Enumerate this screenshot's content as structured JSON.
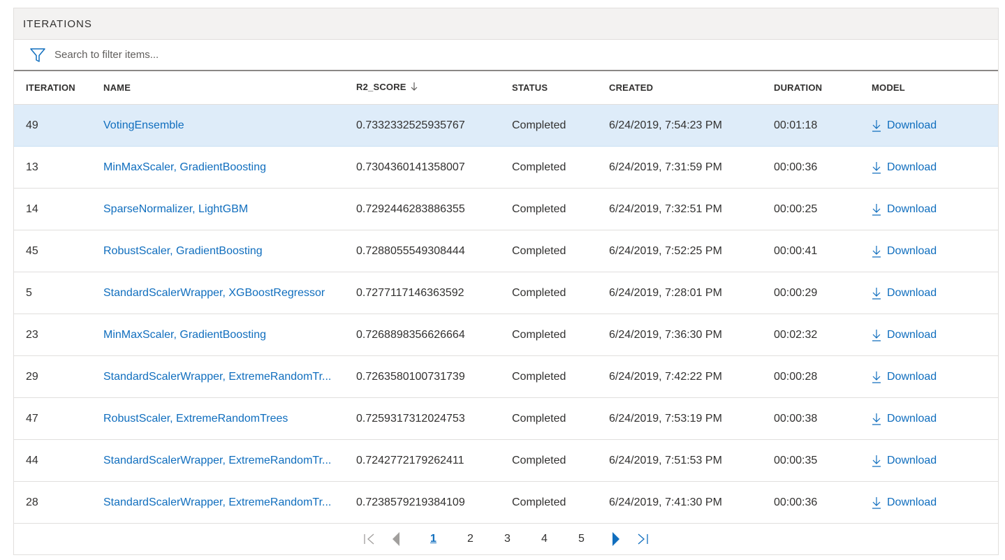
{
  "panel": {
    "title": "ITERATIONS"
  },
  "search": {
    "placeholder": "Search to filter items..."
  },
  "columns": {
    "iteration": "ITERATION",
    "name": "NAME",
    "score": "R2_SCORE",
    "status": "STATUS",
    "created": "CREATED",
    "duration": "DURATION",
    "model": "MODEL"
  },
  "sort": {
    "column": "R2_SCORE",
    "direction": "descending",
    "icon": "arrow-down-icon"
  },
  "rows": [
    {
      "iteration": "49",
      "name": "VotingEnsemble",
      "score": "0.7332332525935767",
      "status": "Completed",
      "created": "6/24/2019, 7:54:23 PM",
      "duration": "00:01:18",
      "model": "Download",
      "selected": true
    },
    {
      "iteration": "13",
      "name": "MinMaxScaler, GradientBoosting",
      "score": "0.7304360141358007",
      "status": "Completed",
      "created": "6/24/2019, 7:31:59 PM",
      "duration": "00:00:36",
      "model": "Download"
    },
    {
      "iteration": "14",
      "name": "SparseNormalizer, LightGBM",
      "score": "0.7292446283886355",
      "status": "Completed",
      "created": "6/24/2019, 7:32:51 PM",
      "duration": "00:00:25",
      "model": "Download"
    },
    {
      "iteration": "45",
      "name": "RobustScaler, GradientBoosting",
      "score": "0.7288055549308444",
      "status": "Completed",
      "created": "6/24/2019, 7:52:25 PM",
      "duration": "00:00:41",
      "model": "Download"
    },
    {
      "iteration": "5",
      "name": "StandardScalerWrapper, XGBoostRegressor",
      "score": "0.7277117146363592",
      "status": "Completed",
      "created": "6/24/2019, 7:28:01 PM",
      "duration": "00:00:29",
      "model": "Download"
    },
    {
      "iteration": "23",
      "name": "MinMaxScaler, GradientBoosting",
      "score": "0.7268898356626664",
      "status": "Completed",
      "created": "6/24/2019, 7:36:30 PM",
      "duration": "00:02:32",
      "model": "Download"
    },
    {
      "iteration": "29",
      "name": "StandardScalerWrapper, ExtremeRandomTr...",
      "score": "0.7263580100731739",
      "status": "Completed",
      "created": "6/24/2019, 7:42:22 PM",
      "duration": "00:00:28",
      "model": "Download"
    },
    {
      "iteration": "47",
      "name": "RobustScaler, ExtremeRandomTrees",
      "score": "0.7259317312024753",
      "status": "Completed",
      "created": "6/24/2019, 7:53:19 PM",
      "duration": "00:00:38",
      "model": "Download"
    },
    {
      "iteration": "44",
      "name": "StandardScalerWrapper, ExtremeRandomTr...",
      "score": "0.7242772179262411",
      "status": "Completed",
      "created": "6/24/2019, 7:51:53 PM",
      "duration": "00:00:35",
      "model": "Download"
    },
    {
      "iteration": "28",
      "name": "StandardScalerWrapper, ExtremeRandomTr...",
      "score": "0.7238579219384109",
      "status": "Completed",
      "created": "6/24/2019, 7:41:30 PM",
      "duration": "00:00:36",
      "model": "Download"
    }
  ],
  "pagination": {
    "pages": [
      "1",
      "2",
      "3",
      "4",
      "5"
    ],
    "current": "1",
    "icons": {
      "first": "first-page-icon",
      "prev": "previous-page-icon",
      "next": "next-page-icon",
      "last": "last-page-icon"
    }
  },
  "colors": {
    "accent": "#106ebe",
    "selected_row": "#deecf9",
    "header_bg": "#f3f2f1",
    "border": "#e1dfdd",
    "disabled": "#a19f9d"
  }
}
